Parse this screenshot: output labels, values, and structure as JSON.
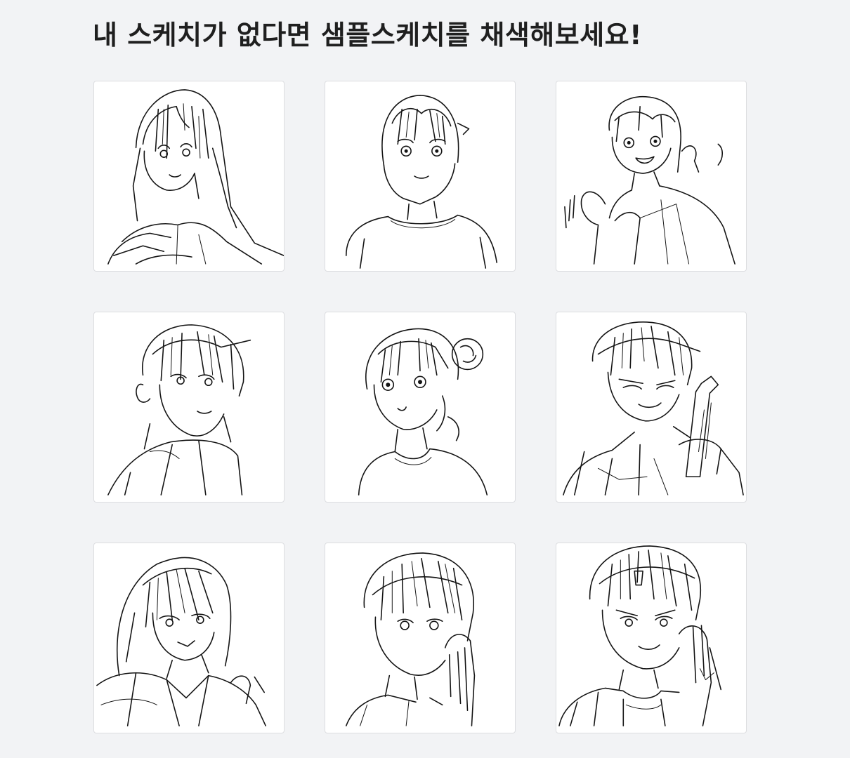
{
  "header": {
    "title": "내 스케치가 없다면 샘플스케치를 채색해보세요!"
  },
  "samples": [
    {
      "name": "sample-sketch-1",
      "subject": "long-hair-girl-looking-back-icon"
    },
    {
      "name": "sample-sketch-2",
      "subject": "bob-hair-girl-front-icon"
    },
    {
      "name": "sample-sketch-3",
      "subject": "smiling-girl-waving-icon"
    },
    {
      "name": "sample-sketch-4",
      "subject": "boy-looking-over-shoulder-icon"
    },
    {
      "name": "sample-sketch-5",
      "subject": "girl-with-hair-bun-icon"
    },
    {
      "name": "sample-sketch-6",
      "subject": "boy-holding-drink-icon"
    },
    {
      "name": "sample-sketch-7",
      "subject": "short-hair-woman-collar-icon"
    },
    {
      "name": "sample-sketch-8",
      "subject": "boy-hand-on-chin-icon"
    },
    {
      "name": "sample-sketch-9",
      "subject": "boy-hand-on-face-icon"
    }
  ]
}
